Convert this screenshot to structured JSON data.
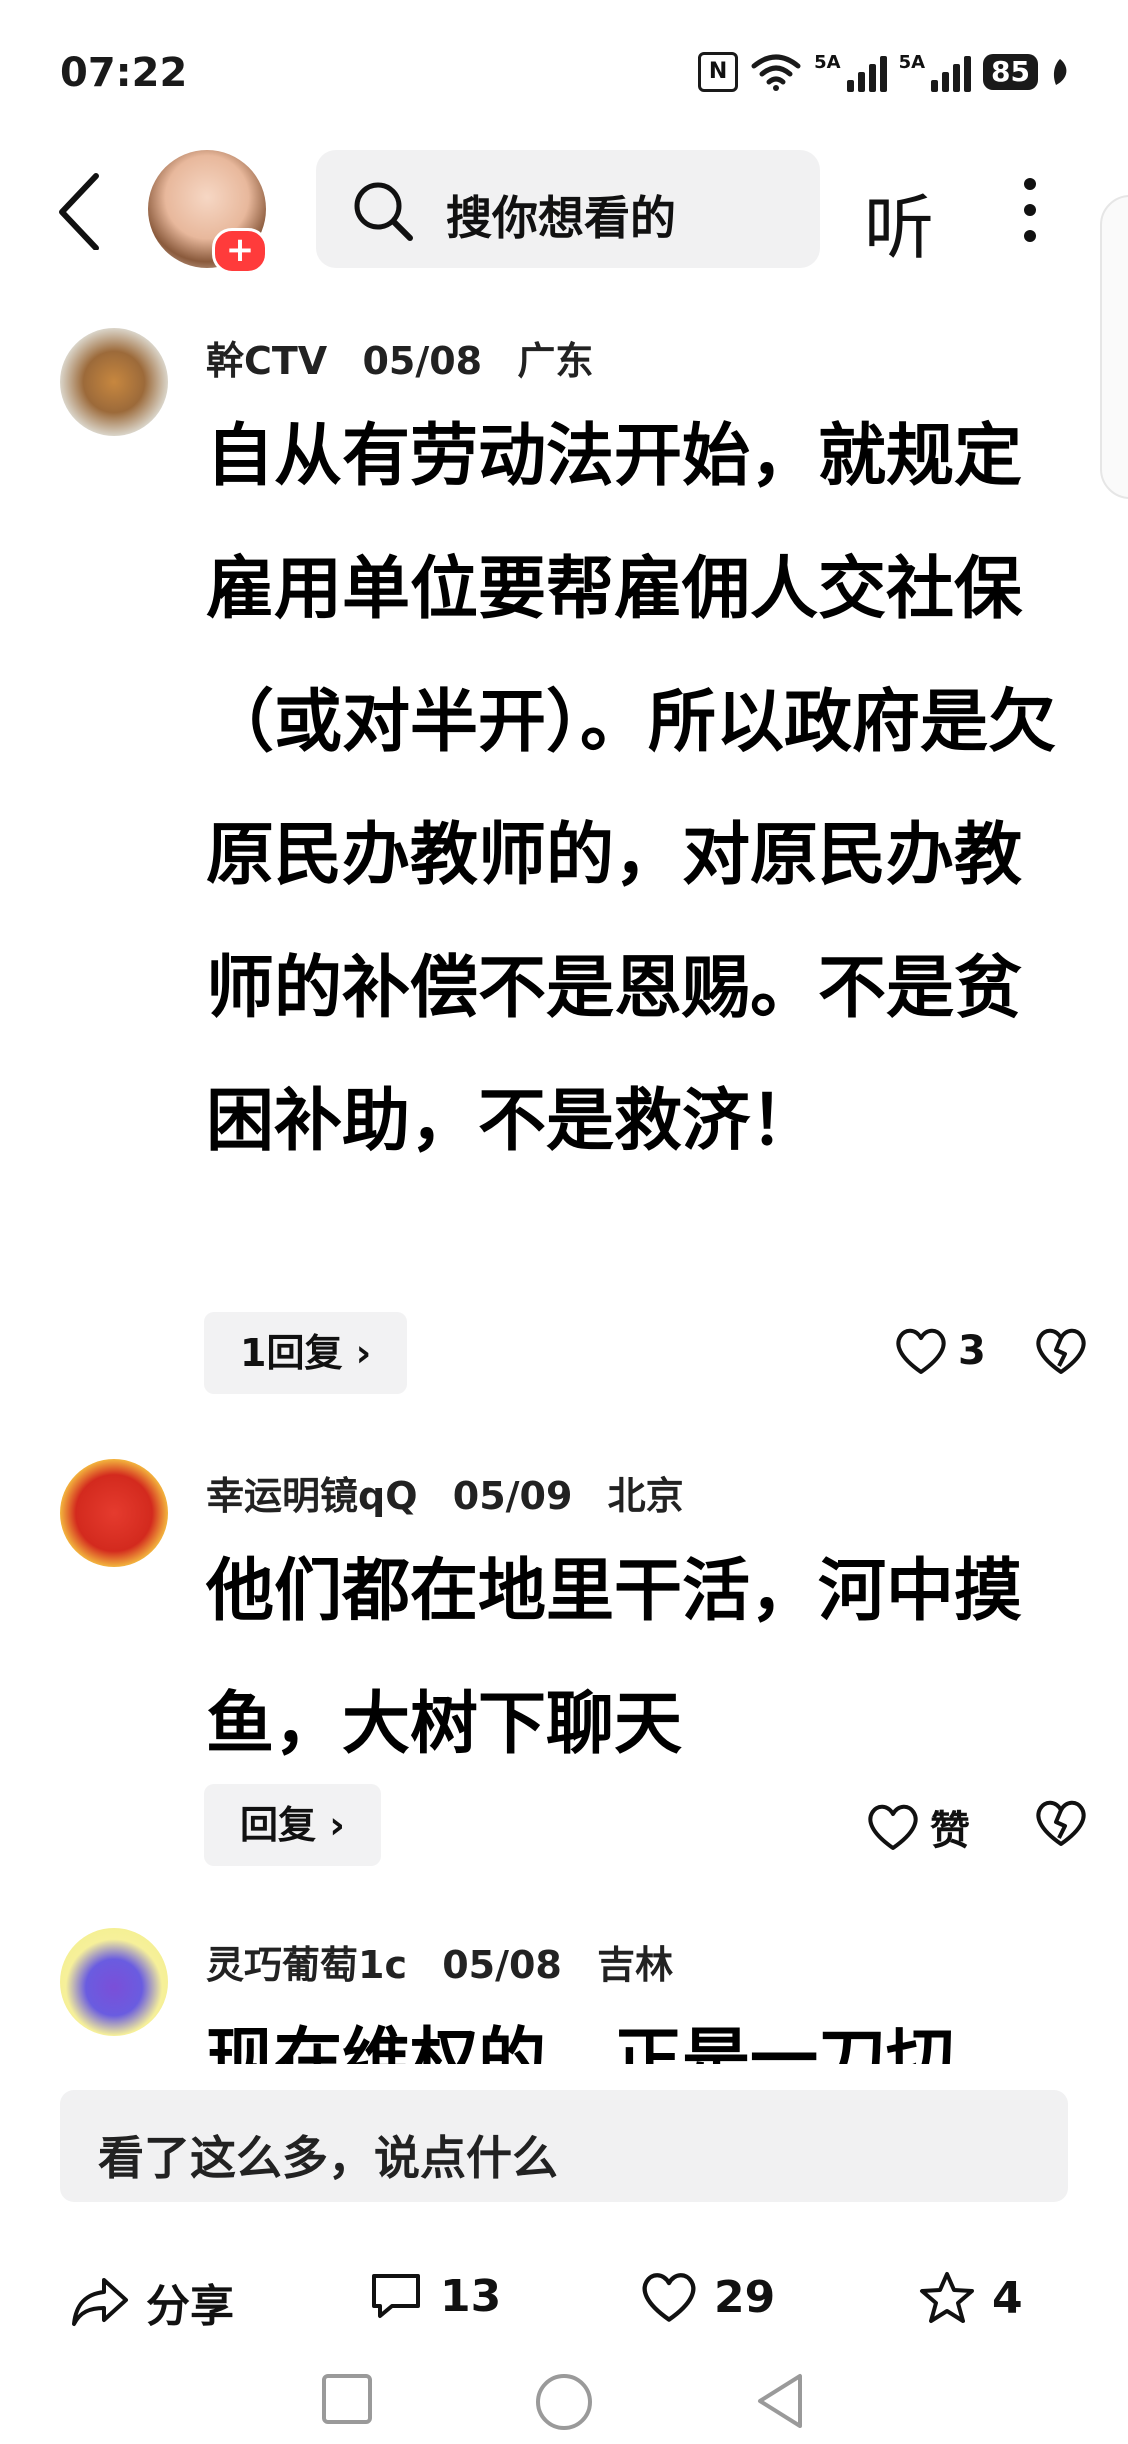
{
  "status_bar": {
    "time": "07:22",
    "signal1_label": "5A",
    "signal2_label": "5A",
    "battery": "85"
  },
  "top_bar": {
    "search_placeholder": "搜你想看的",
    "listen_label": "听"
  },
  "comments": [
    {
      "user": "幹CTV",
      "date": "05/08",
      "location": "广东",
      "text": "自从有劳动法开始，就规定雇用单位要帮雇佣人交社保（或对半开）。所以政府是欠原民办教师的，对原民办教师的补偿不是恩赐。不是贫困补助，不是救济！",
      "reply_label": "1回复 ›",
      "likes": "3"
    },
    {
      "user": "幸运明镜qQ",
      "date": "05/09",
      "location": "北京",
      "text": "他们都在地里干活，河中摸鱼，大树下聊天",
      "reply_label": "回复 ›",
      "likes": "赞"
    },
    {
      "user": "灵巧葡萄1c",
      "date": "05/08",
      "location": "吉林",
      "text": "现在维权的，正是一刀切"
    }
  ],
  "comment_input": {
    "placeholder": "看了这么多，说点什么"
  },
  "actions": {
    "share_label": "分享",
    "comments_count": "13",
    "likes_count": "29",
    "favorites_count": "4"
  }
}
